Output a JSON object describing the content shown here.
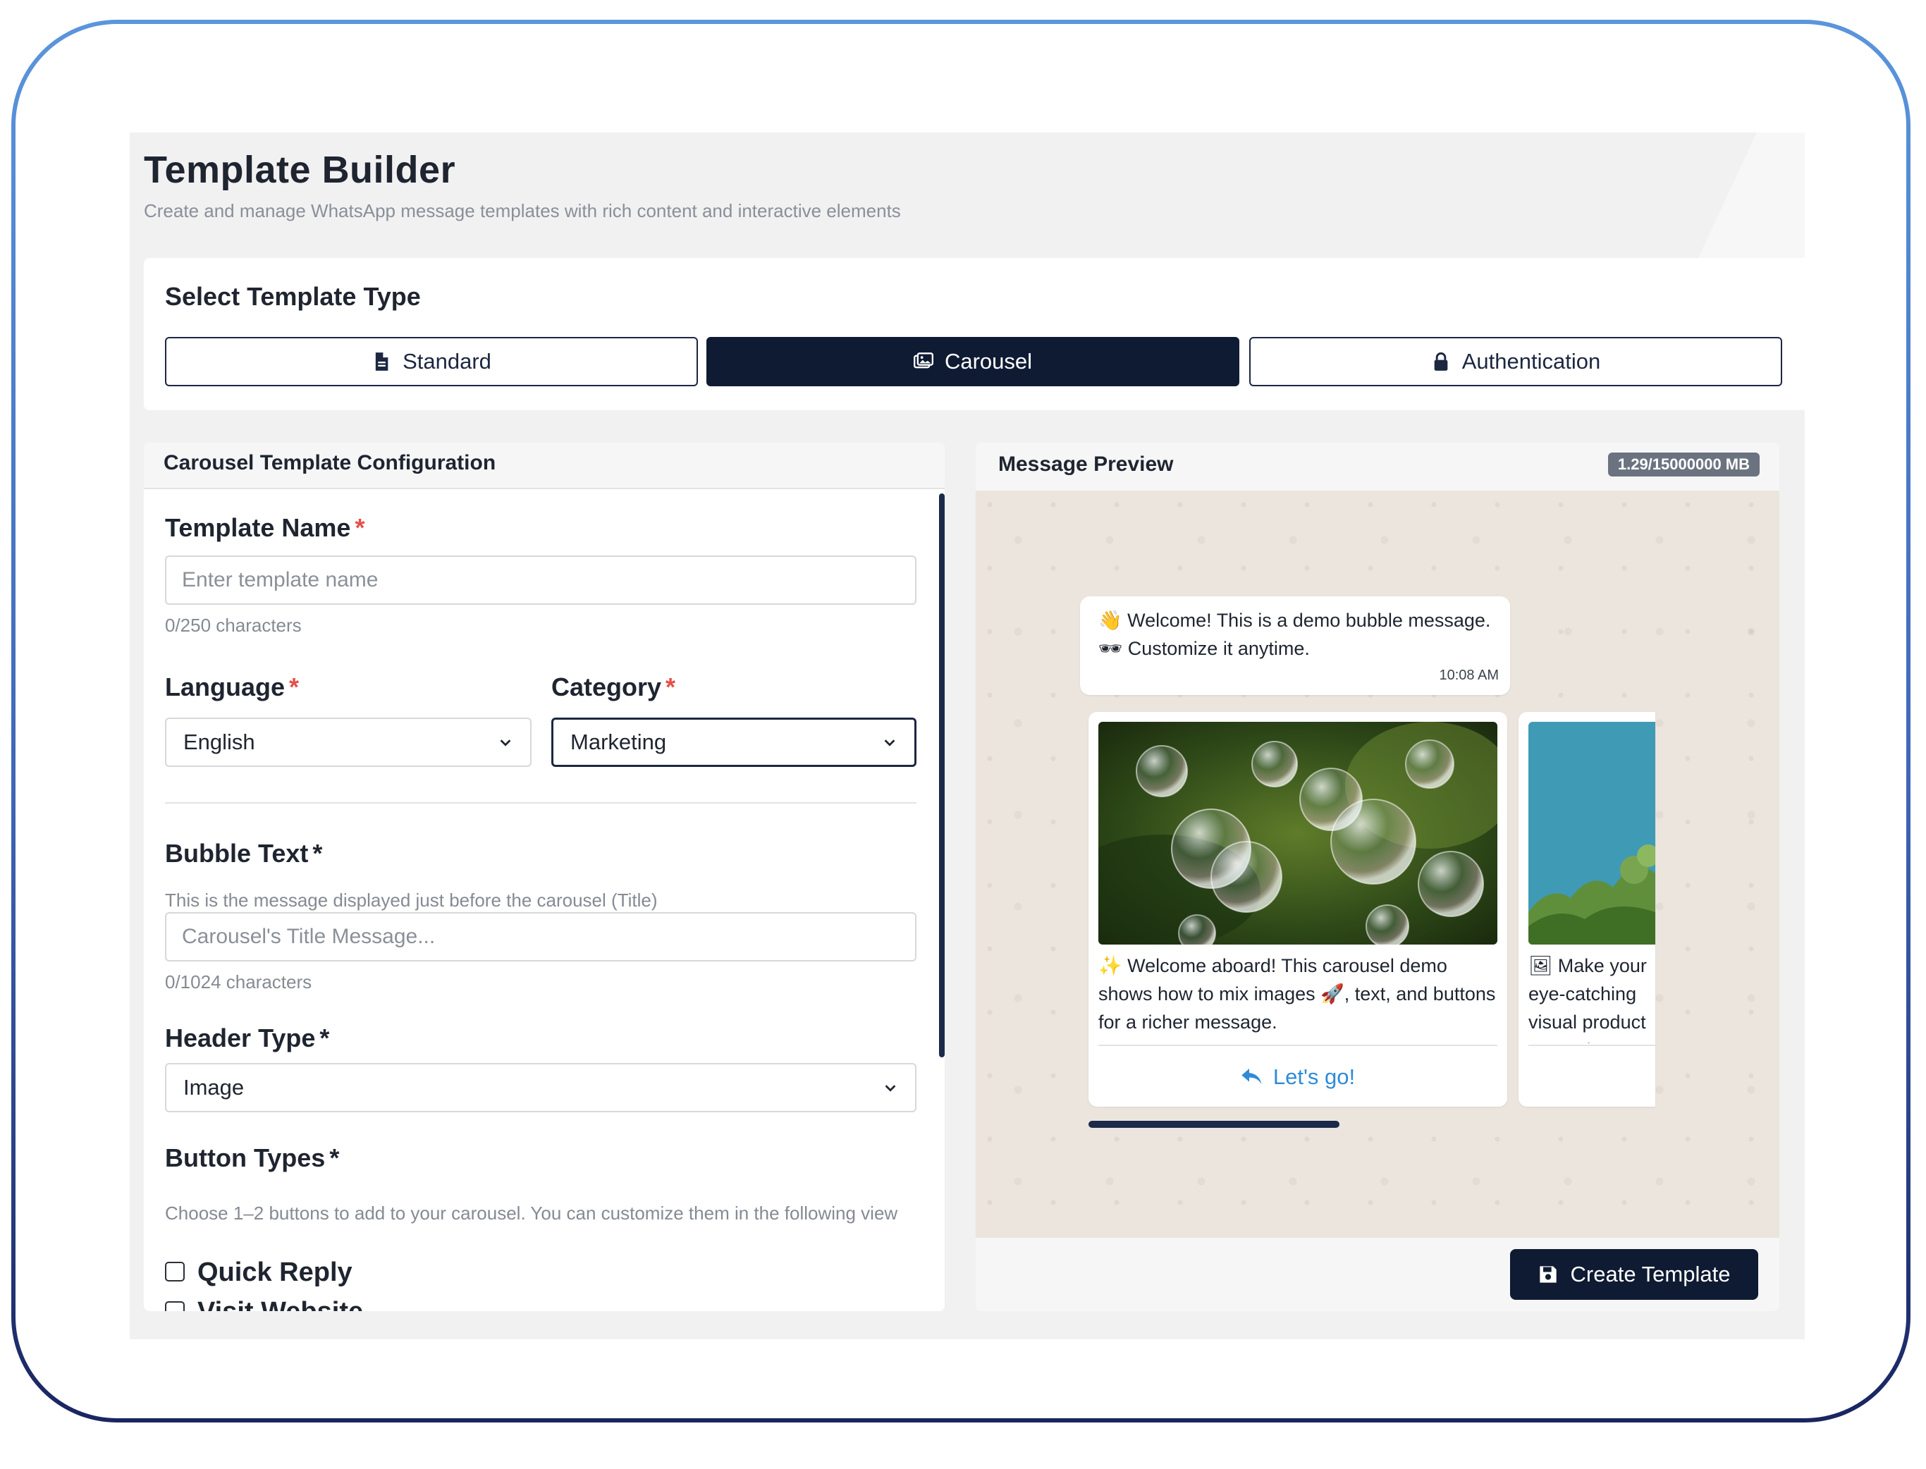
{
  "page": {
    "title": "Template Builder",
    "subtitle": "Create and manage WhatsApp message templates with rich content and interactive elements"
  },
  "template_type": {
    "heading": "Select Template Type",
    "options": [
      {
        "label": "Standard",
        "icon": "file-icon",
        "active": false
      },
      {
        "label": "Carousel",
        "icon": "images-icon",
        "active": true
      },
      {
        "label": "Authentication",
        "icon": "lock-icon",
        "active": false
      }
    ]
  },
  "config": {
    "header": "Carousel Template Configuration",
    "template_name": {
      "label": "Template Name",
      "required_mark": "*",
      "placeholder": "Enter template name",
      "value": "",
      "counter": "0/250 characters"
    },
    "language": {
      "label": "Language",
      "required_mark": "*",
      "value": "English"
    },
    "category": {
      "label": "Category",
      "required_mark": "*",
      "value": "Marketing"
    },
    "bubble_text": {
      "label": "Bubble Text",
      "required_mark": "*",
      "hint": "This is the message displayed just before the carousel (Title)",
      "placeholder": "Carousel's Title Message...",
      "value": "",
      "counter": "0/1024 characters"
    },
    "header_type": {
      "label": "Header Type",
      "required_mark": "*",
      "value": "Image"
    },
    "button_types": {
      "label": "Button Types",
      "required_mark": "*",
      "hint": "Choose 1–2 buttons to add to your carousel. You can customize them in the following view",
      "options": [
        {
          "label": "Quick Reply",
          "checked": false
        },
        {
          "label": "Visit Website",
          "checked": false
        }
      ]
    }
  },
  "preview": {
    "header": "Message Preview",
    "size_badge": "1.29/15000000 MB",
    "bubble": {
      "emoji": "👋",
      "text": "Welcome! This is a demo bubble message.🕶 Customize it anytime.",
      "time": "10:08 AM"
    },
    "cards": [
      {
        "emoji": "✨",
        "text": "Welcome aboard! This carousel demo shows how to mix images 🚀, text, and buttons for a richer message.",
        "button_label": "Let's go!"
      },
      {
        "emoji": "🖼",
        "text": "Make your eye-catching visual product or service"
      }
    ],
    "create_button": "Create Template"
  },
  "colors": {
    "primary": "#0f1b33",
    "link": "#2f8bd8",
    "required": "#e4504a",
    "chat_bg": "#ece5dd"
  }
}
